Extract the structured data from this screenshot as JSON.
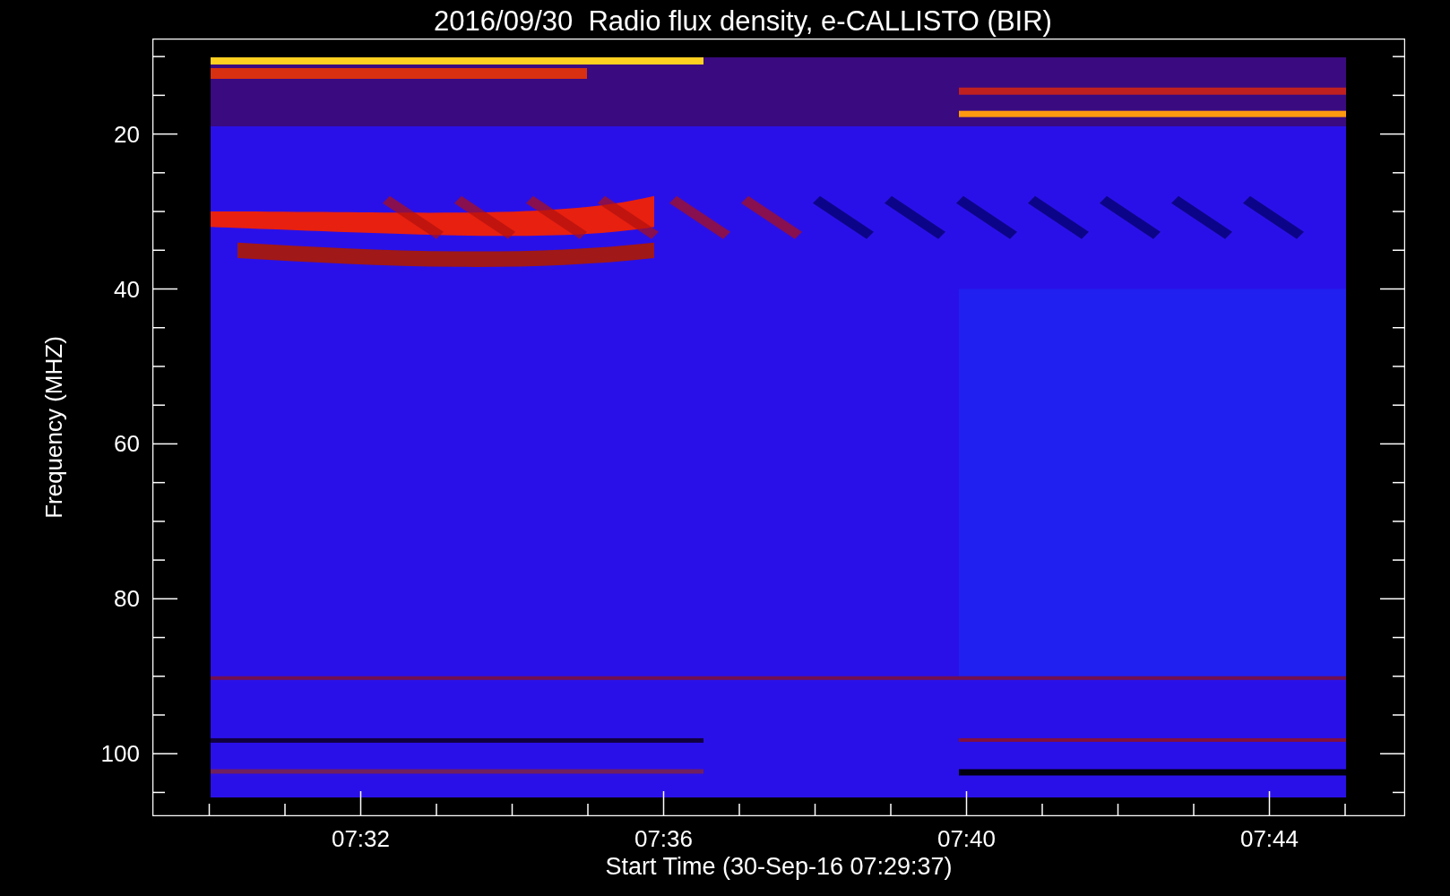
{
  "title": "2016/09/30  Radio flux density, e-CALLISTO (BIR)",
  "y_axis": {
    "label": "Frequency (MHZ)",
    "tick_labels": [
      "20",
      "40",
      "60",
      "80",
      "100"
    ]
  },
  "x_axis": {
    "label": "Start Time (30-Sep-16 07:29:37)",
    "tick_labels": [
      "07:32",
      "07:36",
      "07:40",
      "07:44"
    ]
  }
}
